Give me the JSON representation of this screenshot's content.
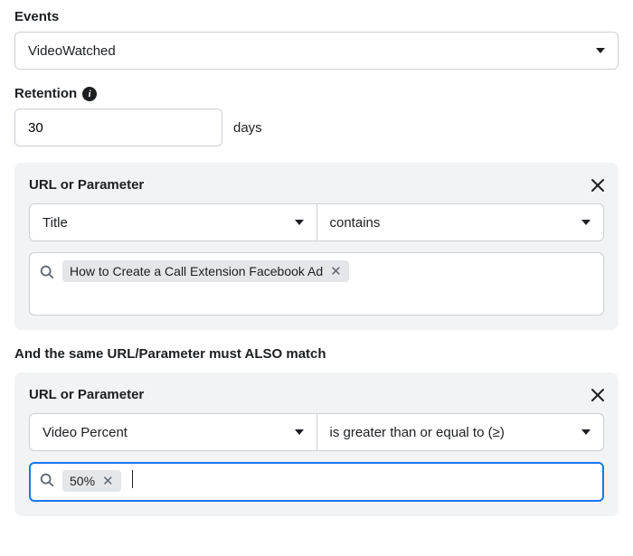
{
  "events": {
    "label": "Events",
    "selected": "VideoWatched"
  },
  "retention": {
    "label": "Retention",
    "value": "30",
    "unit": "days"
  },
  "rule1": {
    "title": "URL or Parameter",
    "param": "Title",
    "operator": "contains",
    "tags": [
      "How to Create a Call Extension Facebook Ad"
    ]
  },
  "also_match_label": "And the same URL/Parameter must ALSO match",
  "rule2": {
    "title": "URL or Parameter",
    "param": "Video Percent",
    "operator": "is greater than or equal to (≥)",
    "tags": [
      "50%"
    ]
  }
}
